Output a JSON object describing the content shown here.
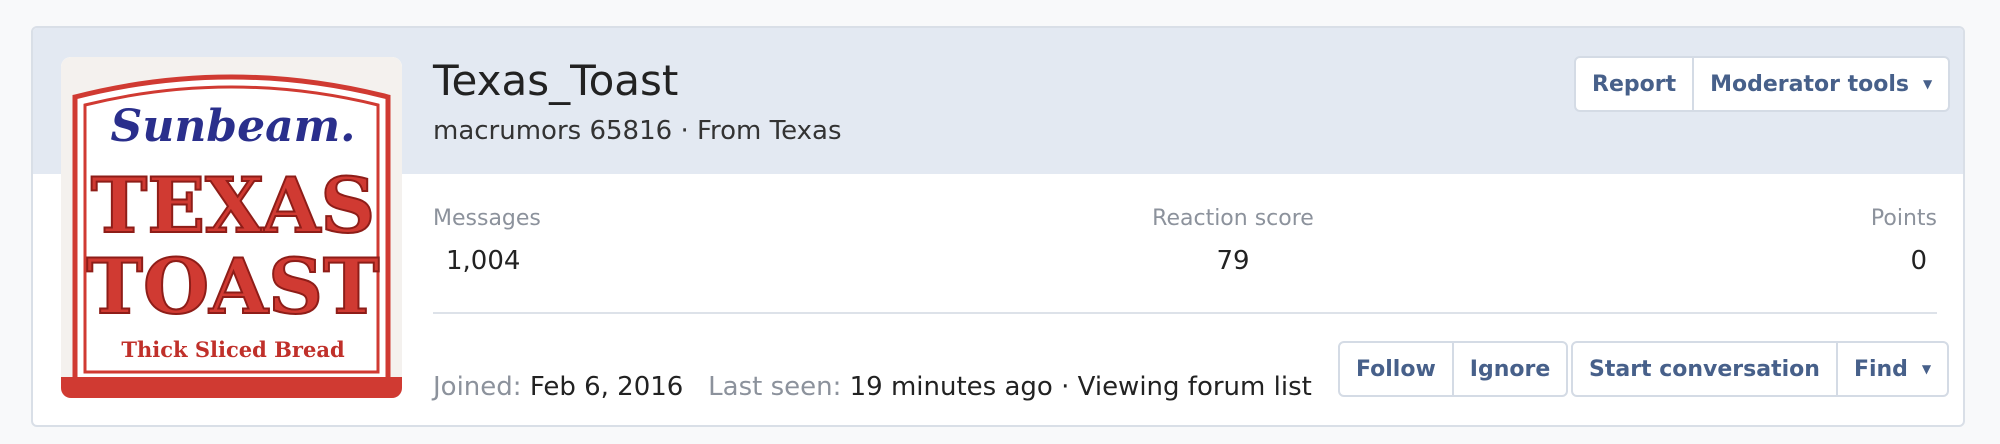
{
  "profile": {
    "username": "Texas_Toast",
    "user_title": "macrumors 65816",
    "location": "From Texas",
    "separator": "·",
    "avatar": {
      "brand": "Sunbeam.",
      "line1": "TEXAS",
      "line2": "TOAST",
      "tagline": "Thick Sliced Bread"
    }
  },
  "header_actions": {
    "report_label": "Report",
    "moderator_tools_label": "Moderator tools"
  },
  "stats": [
    {
      "label": "Messages",
      "value": "1,004"
    },
    {
      "label": "Reaction score",
      "value": "79"
    },
    {
      "label": "Points",
      "value": "0"
    }
  ],
  "footer": {
    "joined_label": "Joined:",
    "joined_value": "Feb 6, 2016",
    "last_seen_label": "Last seen:",
    "last_seen_value": "19 minutes ago",
    "activity": "Viewing forum list"
  },
  "footer_actions": {
    "follow_label": "Follow",
    "ignore_label": "Ignore",
    "start_conversation_label": "Start conversation",
    "find_label": "Find"
  },
  "colors": {
    "header_bg": "#e3e9f2",
    "button_text": "#47608a",
    "avatar_red": "#d03a32",
    "avatar_blue": "#2a2f8c"
  },
  "icons": [
    "chevron-down-icon"
  ]
}
